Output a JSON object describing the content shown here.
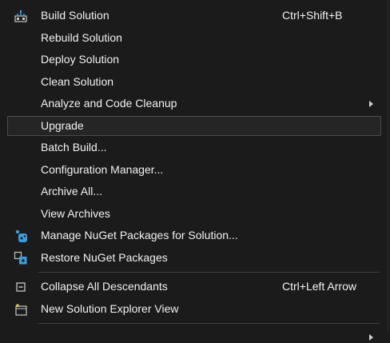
{
  "menu": {
    "items": [
      {
        "label": "Build Solution",
        "shortcut": "Ctrl+Shift+B",
        "icon": "build-solution-icon"
      },
      {
        "label": "Rebuild Solution"
      },
      {
        "label": "Deploy Solution"
      },
      {
        "label": "Clean Solution"
      },
      {
        "label": "Analyze and Code Cleanup",
        "submenu": true
      },
      {
        "label": "Upgrade",
        "highlighted": true
      },
      {
        "label": "Batch Build..."
      },
      {
        "label": "Configuration Manager..."
      },
      {
        "label": "Archive All..."
      },
      {
        "label": "View Archives"
      },
      {
        "label": "Manage NuGet Packages for Solution...",
        "icon": "nuget-icon"
      },
      {
        "label": "Restore NuGet Packages",
        "icon": "restore-packages-icon"
      },
      {
        "label": "Collapse All Descendants",
        "shortcut": "Ctrl+Left Arrow",
        "icon": "collapse-icon"
      },
      {
        "label": "New Solution Explorer View",
        "icon": "new-view-icon"
      }
    ]
  },
  "colors": {
    "background": "#1b1b1c",
    "text": "#f1f1f1",
    "highlight_border": "#4a4a4f",
    "separator": "#3f3f46",
    "icon_blue": "#3c9ddb",
    "icon_gray": "#c5c5c5"
  }
}
